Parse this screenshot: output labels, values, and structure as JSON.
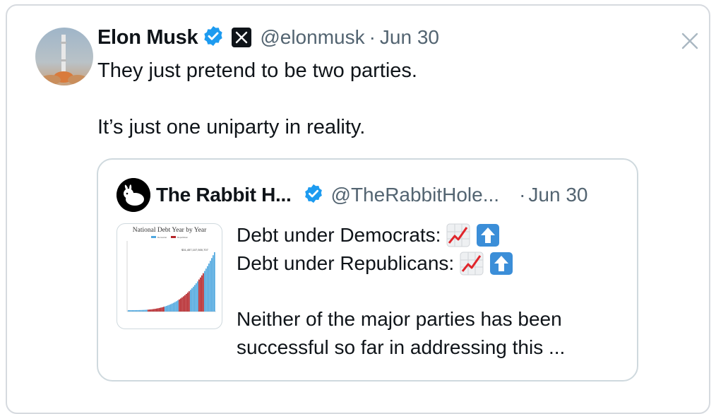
{
  "tweet": {
    "author_name": "Elon Musk",
    "handle": "@elonmusk",
    "separator": "·",
    "date": "Jun 30",
    "line1": "They just pretend to be two parties.",
    "line2": "It’s just one uniparty in reality."
  },
  "quote": {
    "author_name": "The Rabbit H...",
    "handle": "@TheRabbitHole...",
    "separator": "·",
    "date": "Jun 30",
    "line1": "Debt under Democrats:",
    "line2": "Debt under Republicans:",
    "line3": "Neither of the major parties has been",
    "line4": "successful so far in addressing this ...",
    "thumbnail": {
      "title": "National Debt Year by Year",
      "legend": [
        "Democrat",
        "Republican"
      ],
      "value_label": "$31,457,107,500,707"
    }
  },
  "colors": {
    "text": "#0f1419",
    "muted": "#536471",
    "verified_blue": "#1d9bf0",
    "democrat_blue": "#4fa7df",
    "republican_red": "#b5262b"
  },
  "icons": [
    "avatar",
    "verified-badge-icon",
    "x-logo-icon",
    "close-icon",
    "rabbit-logo-icon",
    "chart-increasing-emoji-icon",
    "up-arrow-emoji-icon"
  ]
}
